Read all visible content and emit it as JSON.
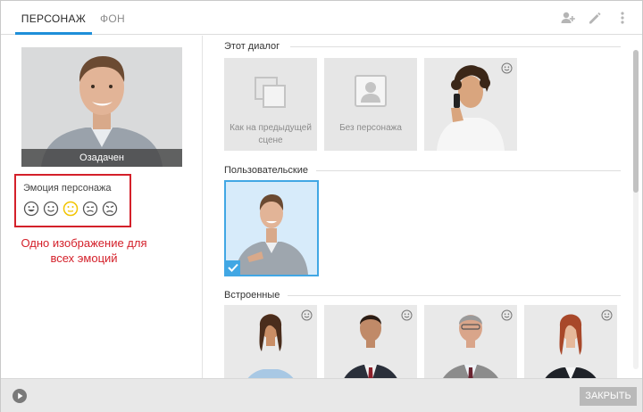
{
  "tabs": [
    {
      "label": "ПЕРСОНАЖ",
      "active": true
    },
    {
      "label": "ФОН",
      "active": false
    }
  ],
  "header_icons": [
    "add-user-icon",
    "pencil-icon",
    "more-vert-icon"
  ],
  "left": {
    "preview_caption": "Озадачен",
    "emotion_label": "Эмоция персонажа",
    "emotions": [
      "happy-emotion-icon",
      "smile-emotion-icon",
      "neutral-emotion-icon",
      "sad-emotion-icon",
      "angry-emotion-icon"
    ],
    "note": "Одно изображение для всех эмоций"
  },
  "sections": {
    "dialog_title": "Этот диалог",
    "dialog_items": [
      {
        "label": "Как на предыдущей сцене",
        "icon": "copy-icon"
      },
      {
        "label": "Без персонажа",
        "icon": "person-placeholder-icon"
      },
      {
        "label": "",
        "icon": "character-photo"
      }
    ],
    "custom_title": "Пользовательские",
    "builtin_title": "Встроенные"
  },
  "footer": {
    "close_label": "ЗАКРЫТЬ"
  },
  "colors": {
    "accent": "#1f8fd9",
    "highlight_red": "#d4202a",
    "selected_bg": "#d7ebfa",
    "emotion_active": "#f2c400"
  }
}
